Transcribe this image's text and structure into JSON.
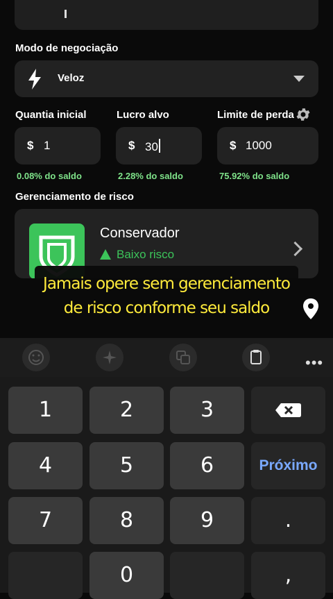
{
  "trade_mode": {
    "label": "Modo de negociação",
    "selected": "Veloz"
  },
  "fields": [
    {
      "label": "Quantia inicial",
      "currency": "$",
      "value": "1",
      "percent": "0.08% do saldo"
    },
    {
      "label": "Lucro alvo",
      "currency": "$",
      "value": "30",
      "percent": "2.28% do saldo"
    },
    {
      "label": "Limite de perda",
      "currency": "$",
      "value": "1000",
      "percent": "75.92% do saldo"
    }
  ],
  "risk": {
    "label": "Gerenciamento de risco",
    "name": "Conservador",
    "level": "Baixo risco"
  },
  "caption": {
    "line1": "Jamais opere sem gerenciamento",
    "line2": "de risco conforme seu saldo"
  },
  "keyboard": {
    "keys": [
      "1",
      "2",
      "3",
      "4",
      "5",
      "6",
      "7",
      "8",
      "9",
      "0",
      ".",
      ","
    ],
    "next_label": "Próximo",
    "more_label": "•••"
  },
  "colors": {
    "accent_green": "#3cc45a",
    "percent_green": "#7fe38a",
    "caption_yellow": "#ffeb3b",
    "next_blue": "#7aa9ff"
  },
  "icons": [
    "bolt-icon",
    "chevron-down-icon",
    "gear-icon",
    "shield-icon",
    "warning-icon",
    "chevron-right-icon",
    "location-pin-icon",
    "emoji-icon",
    "sparkle-icon",
    "translate-icon",
    "clipboard-icon",
    "more-icon",
    "backspace-icon"
  ]
}
